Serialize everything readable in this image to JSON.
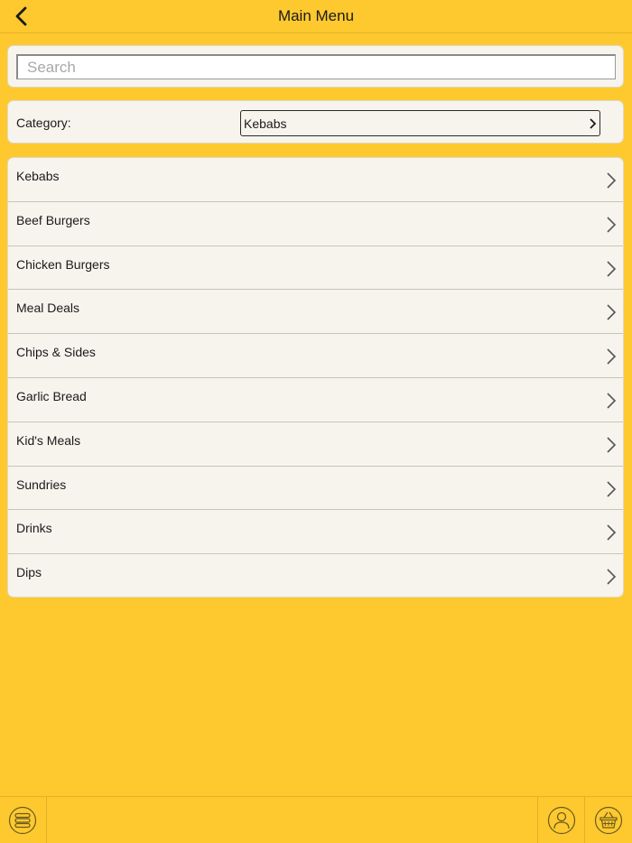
{
  "header": {
    "title": "Main Menu",
    "back_icon": "chevron-left-icon"
  },
  "search": {
    "placeholder": "Search",
    "value": ""
  },
  "category": {
    "label": "Category:",
    "selected": "Kebabs"
  },
  "menu_items": [
    {
      "label": "Kebabs"
    },
    {
      "label": "Beef Burgers"
    },
    {
      "label": "Chicken Burgers"
    },
    {
      "label": "Meal Deals"
    },
    {
      "label": "Chips & Sides"
    },
    {
      "label": "Garlic Bread"
    },
    {
      "label": "Kid's Meals"
    },
    {
      "label": "Sundries"
    },
    {
      "label": "Drinks"
    },
    {
      "label": "Dips"
    }
  ],
  "tabbar": {
    "items": [
      {
        "icon": "menu-stack-icon"
      },
      {
        "icon": "user-icon"
      },
      {
        "icon": "basket-icon"
      }
    ]
  },
  "colors": {
    "background": "#fdc92f",
    "card": "#f7f4ee",
    "text": "#1a1a1a"
  }
}
